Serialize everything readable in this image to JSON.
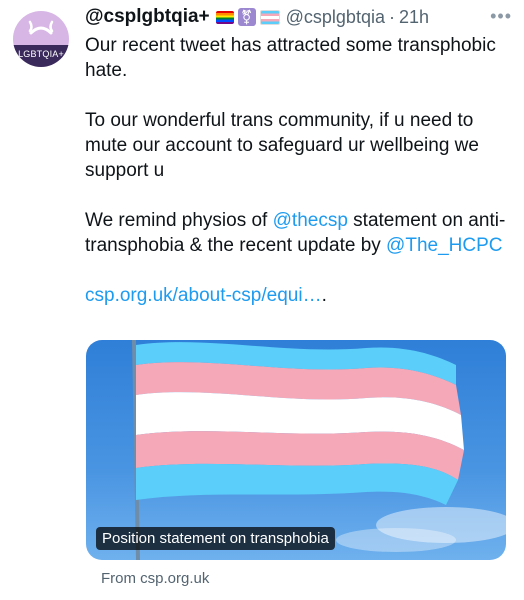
{
  "tweet": {
    "avatar_text": "LGBTQIA+",
    "display_name": "@csplgbtqia+",
    "flags": [
      "rainbow-flag",
      "transgender-symbol",
      "transgender-flag"
    ],
    "handle": "@csplgbtqia",
    "separator": "·",
    "time": "21h",
    "more_label": "•••",
    "paragraph1": "Our recent tweet has attracted some transphobic hate.",
    "paragraph2": "To our wonderful trans community, if u need to mute our account to safeguard ur wellbeing we support u",
    "paragraph3_prefix": "We remind physios of ",
    "mention1": "@thecsp",
    "paragraph3_mid": " statement on anti-transphobia & the recent update by",
    "mention2": "@The_HCPC",
    "link_text": "csp.org.uk/about-csp/equi…",
    "link_suffix": ".",
    "card": {
      "title": "Position statement on transphobia",
      "source": "From csp.org.uk"
    },
    "colors": {
      "link": "#1d9bf0",
      "muted": "#536471",
      "trans_blue": "#5bcefa",
      "trans_pink": "#f5a9b8"
    }
  }
}
